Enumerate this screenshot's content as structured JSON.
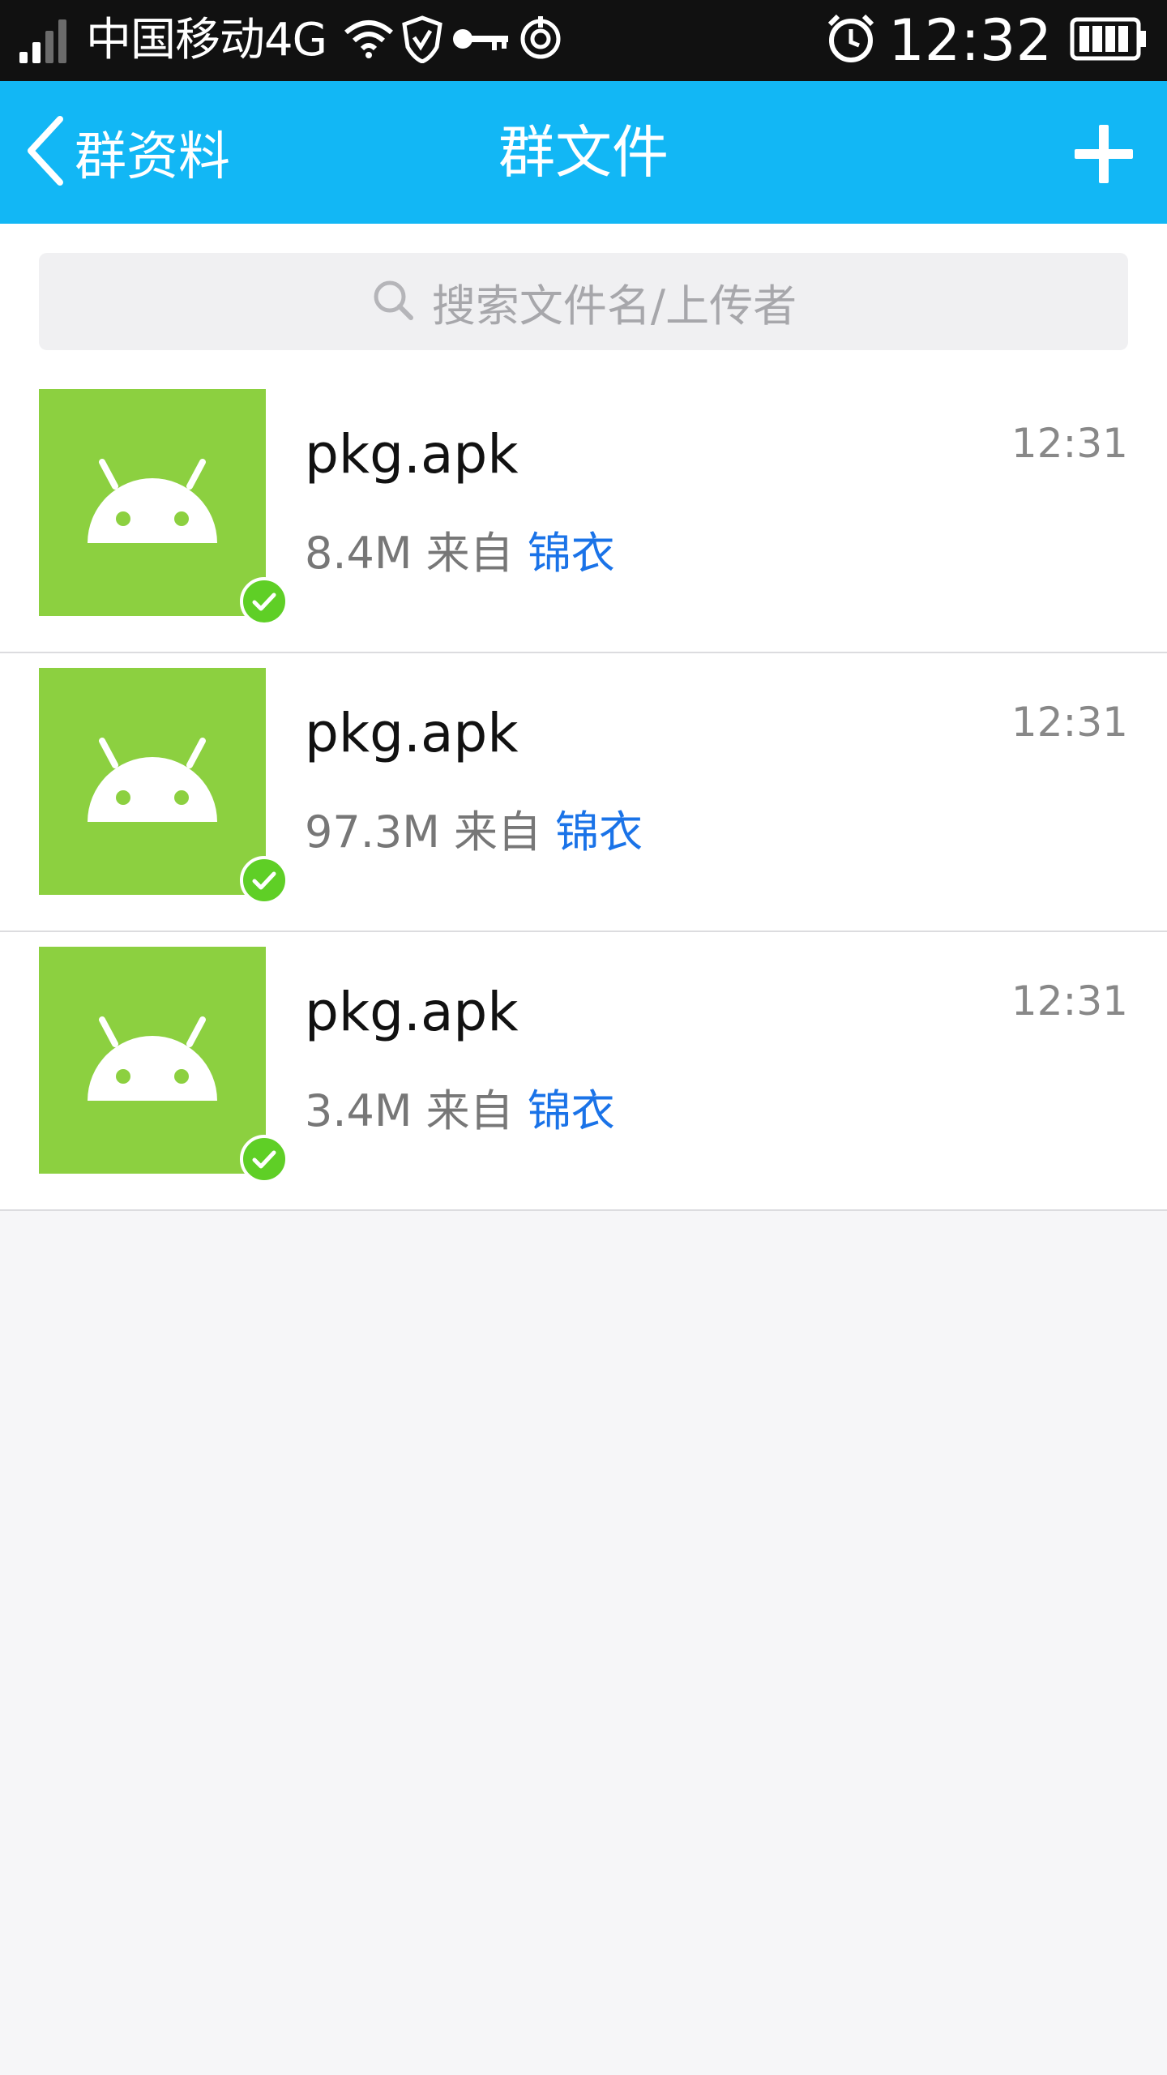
{
  "status_bar": {
    "carrier": "中国移动4G",
    "time": "12:32",
    "icons": [
      "signal-icon",
      "wifi-icon",
      "shield-icon",
      "key-icon",
      "target-icon",
      "alarm-icon",
      "battery-icon"
    ]
  },
  "nav": {
    "back_label": "群资料",
    "title": "群文件",
    "add_icon": "plus-icon"
  },
  "search": {
    "placeholder": "搜索文件名/上传者",
    "icon": "search-icon"
  },
  "files": [
    {
      "name": "pkg.apk",
      "size": "8.4M",
      "from_label": "来自",
      "uploader": "锦衣",
      "time": "12:31"
    },
    {
      "name": "pkg.apk",
      "size": "97.3M",
      "from_label": "来自",
      "uploader": "锦衣",
      "time": "12:31"
    },
    {
      "name": "pkg.apk",
      "size": "3.4M",
      "from_label": "来自",
      "uploader": "锦衣",
      "time": "12:31"
    }
  ],
  "colors": {
    "nav_bg": "#12b7f5",
    "thumb_bg": "#8cd040",
    "check_bg": "#5fcf26",
    "uploader_link": "#1a73e8"
  }
}
